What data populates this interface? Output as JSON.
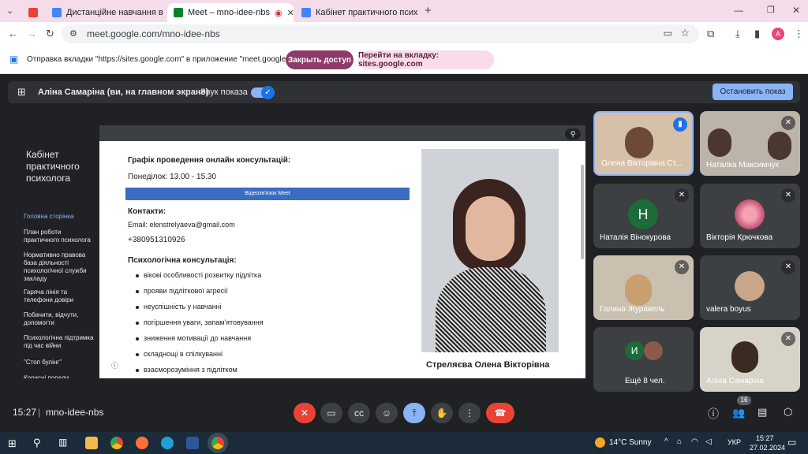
{
  "tabs": [
    {
      "label": "",
      "icon": "gmail-icon"
    },
    {
      "label": "Дистанційне навчання в ВСП",
      "icon": "site-icon"
    },
    {
      "label": "Meet – mno-idee-nbs",
      "icon": "meet-icon"
    },
    {
      "label": "Кабінет практичного псих",
      "icon": "site-icon"
    }
  ],
  "address": "meet.google.com/mno-idee-nbs",
  "profile_initial": "A",
  "infobar": {
    "message": "Отправка вкладки \"https://sites.google.com\" в приложение \"meet.google.com\"...",
    "stop_label": "Закрыть доступ",
    "switch_label": "Перейти на вкладку: sites.google.com"
  },
  "sharebar": {
    "presenter": "Аліна Самаріна (ви, на главном экране)",
    "sound": "Звук показа",
    "stop": "Остановить показ"
  },
  "site": {
    "title_lines": [
      "Кабінет",
      "практичного",
      "психолога"
    ],
    "nav": [
      "Головна сторінка",
      "План роботи практичного психолога",
      "Нормативно правова база діяльності психологічної служби закладу",
      "Гаряча лінія та телефони довіри",
      "Побачити, відчути, допомогти",
      "Психологічна підтримка під час війни",
      "\"Стоп булінг\"",
      "Корисні поради"
    ],
    "schedule_heading": "Графік проведення онлайн консультацій:",
    "schedule_time": "Понеділок: 13.00 - 15.30",
    "meet_button": "Відеозв'язок Meet",
    "contacts_heading": "Контакти:",
    "email": "Email: elenstrelyaeva@gmail.com",
    "phone": "+380951310926",
    "consult_heading": "Психологічна консультація:",
    "items": [
      "вікові особливості розвитку підлітка",
      "прояви підліткової агресії",
      "неуспішність у навчанні",
      "погіршення уваги, запам'ятовування",
      "зниження мотивації до навчання",
      "складнощі в спілкуванні",
      "взаєморозуміння з підлітком"
    ],
    "photo_name": "Стреляєва Олена Вікторівна"
  },
  "participants": [
    {
      "name": "Олена Вікторівна Ст...",
      "initial": ""
    },
    {
      "name": "Наталка Максимчук",
      "initial": ""
    },
    {
      "name": "Наталія Вінокурова",
      "initial": "Н"
    },
    {
      "name": "Вікторія Крючкова",
      "initial": ""
    },
    {
      "name": "Галина Журавель",
      "initial": ""
    },
    {
      "name": "valera boyus",
      "initial": ""
    },
    {
      "name": "Ещё 8 чел.",
      "initial": "И"
    },
    {
      "name": "Аліна Самаріна",
      "initial": ""
    }
  ],
  "meeting": {
    "time": "15:27",
    "code": "mno-idee-nbs",
    "people_count": "16"
  },
  "taskbar": {
    "weather": "14°C  Sunny",
    "lang": "УКР",
    "time": "15:27",
    "date": "27.02.2024"
  },
  "colors": {
    "accent": "#1a73e8",
    "danger": "#ea4335",
    "present": "#8ab4f8"
  }
}
